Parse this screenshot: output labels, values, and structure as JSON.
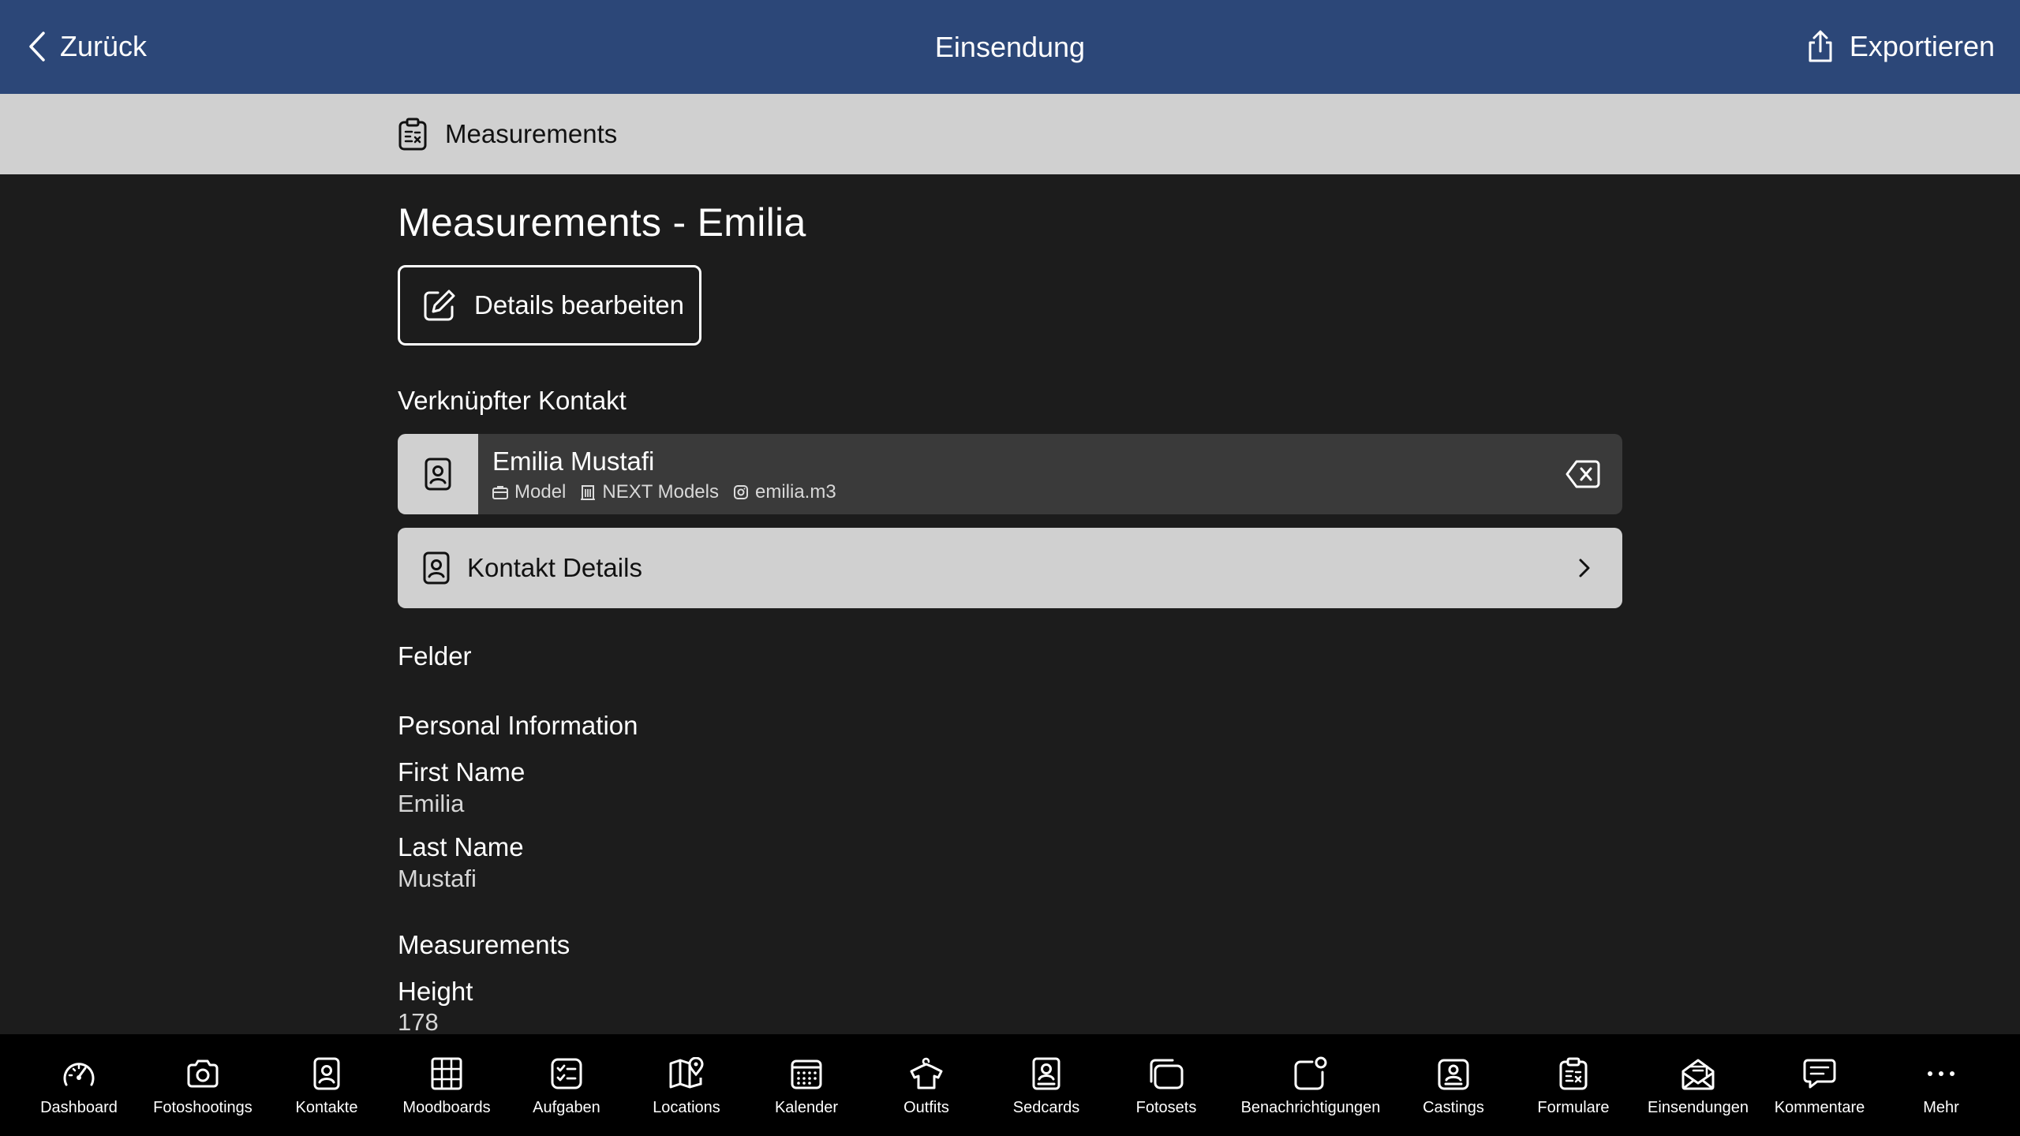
{
  "nav": {
    "back_label": "Zurück",
    "title": "Einsendung",
    "export_label": "Exportieren"
  },
  "section": {
    "label": "Measurements"
  },
  "submission": {
    "title": "Measurements - Emilia",
    "edit_button": "Details bearbeiten"
  },
  "linked_contact": {
    "heading": "Verknüpfter Kontakt",
    "name": "Emilia Mustafi",
    "role": "Model",
    "agency": "NEXT Models",
    "instagram": "emilia.m3",
    "details_label": "Kontakt Details"
  },
  "fields": {
    "heading": "Felder",
    "groups": [
      {
        "title": "Personal Information",
        "items": [
          {
            "label": "First Name",
            "value": "Emilia"
          },
          {
            "label": "Last Name",
            "value": "Mustafi"
          }
        ]
      },
      {
        "title": "Measurements",
        "items": [
          {
            "label": "Height",
            "value": "178"
          }
        ]
      }
    ]
  },
  "tabs": [
    {
      "label": "Dashboard",
      "icon": "gauge-icon"
    },
    {
      "label": "Fotoshootings",
      "icon": "camera-icon"
    },
    {
      "label": "Kontakte",
      "icon": "contact-card-icon"
    },
    {
      "label": "Moodboards",
      "icon": "grid-board-icon"
    },
    {
      "label": "Aufgaben",
      "icon": "checklist-icon"
    },
    {
      "label": "Locations",
      "icon": "map-pin-icon"
    },
    {
      "label": "Kalender",
      "icon": "calendar-icon"
    },
    {
      "label": "Outfits",
      "icon": "hanger-shirt-icon"
    },
    {
      "label": "Sedcards",
      "icon": "portrait-card-icon"
    },
    {
      "label": "Fotosets",
      "icon": "photo-stack-icon"
    },
    {
      "label": "Benachrichtigungen",
      "icon": "notification-badge-icon"
    },
    {
      "label": "Castings",
      "icon": "id-badge-icon"
    },
    {
      "label": "Formulare",
      "icon": "clipboard-form-icon"
    },
    {
      "label": "Einsendungen",
      "icon": "mail-open-icon"
    },
    {
      "label": "Kommentare",
      "icon": "comment-icon"
    },
    {
      "label": "Mehr",
      "icon": "more-dots-icon"
    }
  ],
  "colors": {
    "nav_background": "#2c4778",
    "section_band": "#d0d0d0",
    "content_background": "#1c1c1c",
    "card_background": "#3a3a3a",
    "tabbar_background": "#000000"
  }
}
